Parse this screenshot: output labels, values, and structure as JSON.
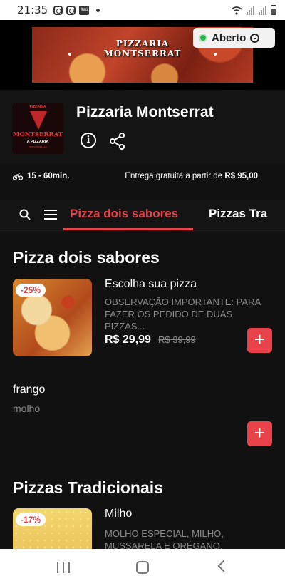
{
  "status_bar": {
    "time": "21:35",
    "bank_icon_label": "Itaú"
  },
  "banner": {
    "title_line1": "PIZZARIA",
    "title_line2": "MONTSERRAT"
  },
  "open_status": {
    "label": "Aberto",
    "color": "#2db24a"
  },
  "store": {
    "name": "Pizzaria Montserrat",
    "logo": {
      "line1": "PIZZARIA",
      "line2": "MONTSERRAT",
      "line3": "A PIZZARIA",
      "line4": "RENOMADA"
    }
  },
  "delivery": {
    "time": "15 - 60min.",
    "free_label": "Entrega gratuita a partir de",
    "free_min": "R$ 95,00"
  },
  "tabs": {
    "active": "Pizza dois sabores",
    "next": "Pizzas Tra"
  },
  "accent_color": "#e8424a",
  "sections": [
    {
      "title": "Pizza dois sabores",
      "items": [
        {
          "discount": "-25%",
          "name": "Escolha sua pizza",
          "description": "OBSERVAÇÃO IMPORTANTE: PARA FAZER OS PEDIDO DE DUAS PIZZAS...",
          "price": "R$ 29,99",
          "old_price": "R$ 39,99",
          "add": "+"
        },
        {
          "name": "frango",
          "description": "molho",
          "add": "+"
        }
      ]
    },
    {
      "title": "Pizzas Tradicionais",
      "items": [
        {
          "discount": "-17%",
          "name": "Milho",
          "description": "MOLHO ESPECIAL, MILHO, MUSSARELA E ORÉGANO."
        }
      ]
    }
  ]
}
